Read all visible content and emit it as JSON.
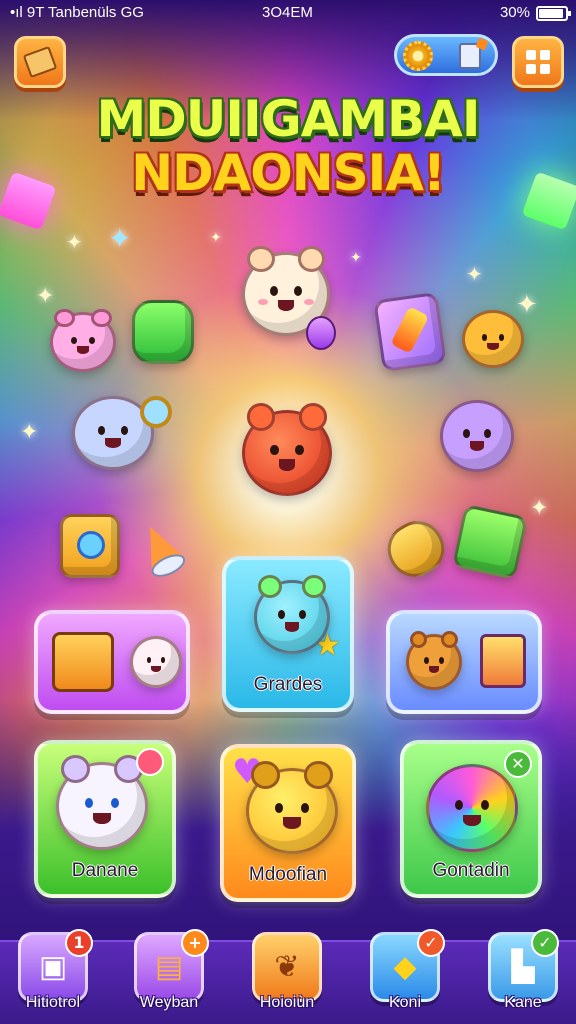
{
  "status_bar": {
    "left_text": "•ıl 9T Tanbenüls  GG",
    "time": "3O4EM",
    "battery": "30%"
  },
  "top_left_button": {
    "icon": "map-scroll-icon"
  },
  "top_right": {
    "settings_icon": "gear-icon",
    "notes_icon": "document-icon",
    "menu_icon": "grid-icon"
  },
  "title": {
    "line1": "MDUIIGAMBAI",
    "line2": "NDAONSIA!"
  },
  "game_cards": [
    {
      "label": "",
      "icon": "chest-and-bear-icon",
      "color": "#e27bff"
    },
    {
      "label": "Grardes",
      "icon": "blue-bear-icon",
      "color": "#5ad8ff"
    },
    {
      "label": "",
      "icon": "bear-and-book-icon",
      "color": "#7ab8ff"
    },
    {
      "label": "Danane",
      "icon": "white-bear-icon",
      "color": "#8ee83a"
    },
    {
      "label": "Mdoofian",
      "icon": "yellow-bear-icon",
      "color": "#ffb020"
    },
    {
      "label": "Gontadin",
      "icon": "rainbow-bear-icon",
      "color": "#79e84a"
    }
  ],
  "card_badge_close": "✕",
  "nav": [
    {
      "label": "Hitiotrol",
      "badge": "1",
      "color": "#b77cff"
    },
    {
      "label": "Weyban",
      "badge": "+",
      "color": "#c77cff"
    },
    {
      "label": "Hoioiùn",
      "badge": "",
      "color": "#ffa93a"
    },
    {
      "label": "Koni",
      "badge": "✓",
      "color": "#4ab8ff"
    },
    {
      "label": "Kane",
      "badge": "✓",
      "color": "#5ac8ff"
    }
  ]
}
